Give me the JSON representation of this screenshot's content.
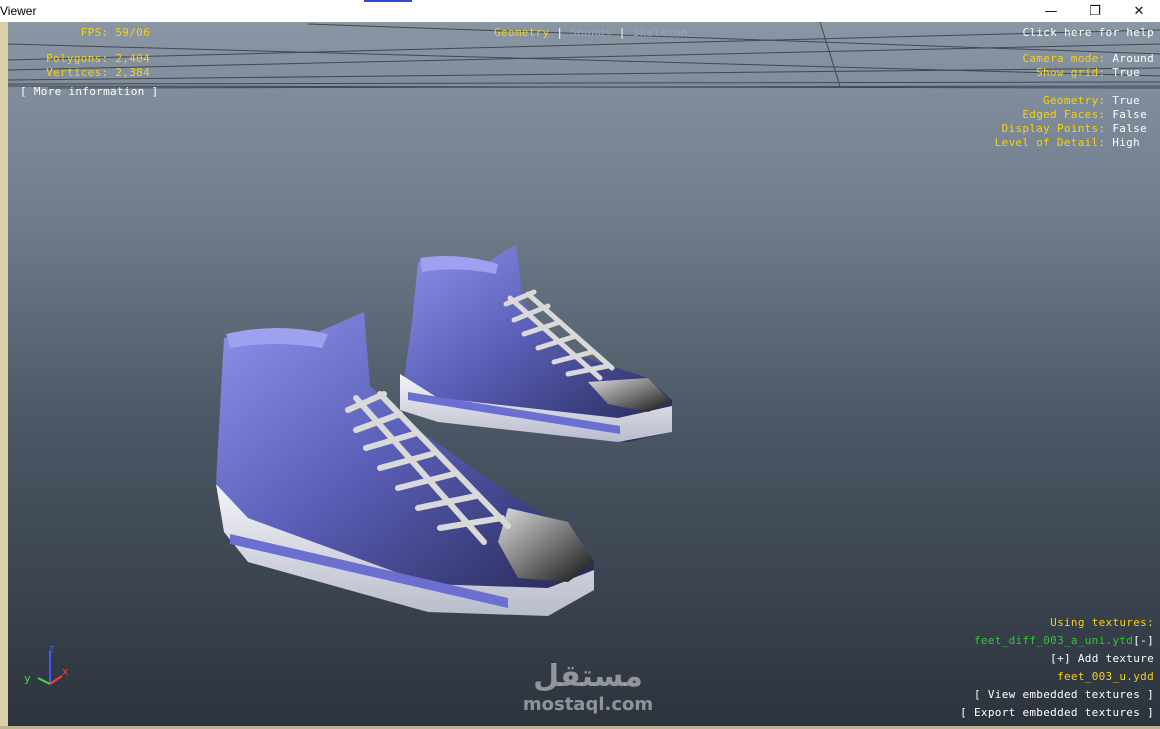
{
  "window": {
    "title": "Viewer",
    "minimize_glyph": "—",
    "restore_glyph": "❐",
    "close_glyph": "✕"
  },
  "stats": {
    "fps_label": "FPS:",
    "fps_value": "59/06",
    "polygons_label": "Polygons:",
    "polygons_value": "2,404",
    "vertices_label": "Vertices:",
    "vertices_value": "2,384",
    "more_info": "[ More information ]"
  },
  "tabs": {
    "geometry": "Geometry",
    "sep1": "|",
    "sounds": "Sounds",
    "sep2": "|",
    "skeleton": "Skeleton"
  },
  "help": {
    "label": "Click here for help"
  },
  "camera": {
    "mode_label": "Camera mode:",
    "mode_value": "Around",
    "grid_label": "Show grid:",
    "grid_value": "True"
  },
  "display": {
    "geometry_label": "Geometry:",
    "geometry_value": "True",
    "edged_label": "Edged Faces:",
    "edged_value": "False",
    "points_label": "Display Points:",
    "points_value": "False",
    "lod_label": "Level of Detail:",
    "lod_value": "High"
  },
  "textures": {
    "heading": "Using textures:",
    "file": "feet_diff_003_a_uni.ytd",
    "remove": "[-]",
    "add": "[+] Add texture",
    "model": "feet_003_u.ydd",
    "view": "[ View embedded textures ]",
    "export": "[ Export embedded textures ]"
  },
  "axes": {
    "z": "z",
    "y": "y",
    "x": "x"
  },
  "watermark": {
    "arabic": "مستقل",
    "latin": "mostaql.com"
  },
  "colors": {
    "label": "#f2d21b",
    "value": "#ffffff",
    "texture_file": "#34c43a",
    "shoe_body": "#5a5fb8",
    "shoe_sole": "#e8e8f2"
  }
}
